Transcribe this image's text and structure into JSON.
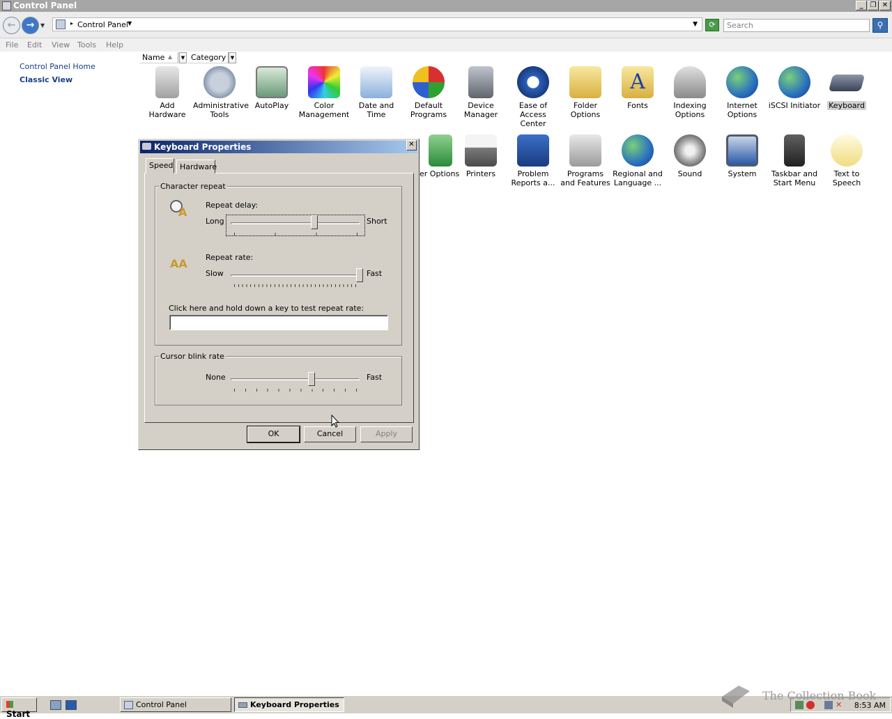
{
  "window": {
    "title": "Control Panel"
  },
  "address": {
    "path": "Control Panel",
    "search_placeholder": "Search"
  },
  "menu": [
    "File",
    "Edit",
    "View",
    "Tools",
    "Help"
  ],
  "left_pane": {
    "home": "Control Panel Home",
    "classic_view": "Classic View"
  },
  "columns": {
    "name": "Name",
    "category": "Category"
  },
  "icons_row1": [
    {
      "label": "Add Hardware",
      "icon": "add-hardware-icon"
    },
    {
      "label": "Administrative Tools",
      "icon": "admin-tools-icon"
    },
    {
      "label": "AutoPlay",
      "icon": "autoplay-icon"
    },
    {
      "label": "Color Management",
      "icon": "color-management-icon"
    },
    {
      "label": "Date and Time",
      "icon": "calendar-clock-icon"
    },
    {
      "label": "Default Programs",
      "icon": "default-programs-icon"
    },
    {
      "label": "Device Manager",
      "icon": "device-manager-icon"
    },
    {
      "label": "Ease of Access Center",
      "icon": "ease-of-access-icon"
    },
    {
      "label": "Folder Options",
      "icon": "folder-options-icon"
    },
    {
      "label": "Fonts",
      "icon": "fonts-folder-icon"
    },
    {
      "label": "Indexing Options",
      "icon": "indexing-icon"
    },
    {
      "label": "Internet Options",
      "icon": "internet-options-icon"
    },
    {
      "label": "iSCSI Initiator",
      "icon": "iscsi-icon"
    },
    {
      "label": "Keyboard",
      "icon": "keyboard-icon"
    }
  ],
  "icons_row2": [
    {
      "label": "er Options",
      "icon": "power-options-icon"
    },
    {
      "label": "Printers",
      "icon": "printer-icon"
    },
    {
      "label": "Problem Reports a...",
      "icon": "problem-reports-icon"
    },
    {
      "label": "Programs and Features",
      "icon": "programs-features-icon"
    },
    {
      "label": "Regional and Language ...",
      "icon": "regional-globe-icon"
    },
    {
      "label": "Sound",
      "icon": "speaker-icon"
    },
    {
      "label": "System",
      "icon": "system-monitor-icon"
    },
    {
      "label": "Taskbar and Start Menu",
      "icon": "taskbar-icon"
    },
    {
      "label": "Text to Speech",
      "icon": "speech-bubble-icon"
    }
  ],
  "dialog": {
    "title": "Keyboard Properties",
    "tabs": [
      "Speed",
      "Hardware"
    ],
    "char_repeat": {
      "group_title": "Character repeat",
      "delay_label": "Repeat delay:",
      "delay_min": "Long",
      "delay_max": "Short",
      "delay_value": 0.62,
      "rate_label": "Repeat rate:",
      "rate_min": "Slow",
      "rate_max": "Fast",
      "rate_value": 1.0,
      "test_label": "Click here and hold down a key to test repeat rate:",
      "test_value": ""
    },
    "cursor_blink": {
      "group_title": "Cursor blink rate",
      "min": "None",
      "max": "Fast",
      "value": 0.6
    },
    "buttons": {
      "ok": "OK",
      "cancel": "Cancel",
      "apply": "Apply"
    }
  },
  "taskbar": {
    "start": "Start",
    "tasks": [
      "Control Panel",
      "Keyboard Properties"
    ],
    "time": "8:53 AM"
  },
  "watermark": "The Collection Book",
  "colors": {
    "title_gradient_start": "#0a246a",
    "title_gradient_end": "#a6caf0",
    "face": "#d4d0c8"
  }
}
